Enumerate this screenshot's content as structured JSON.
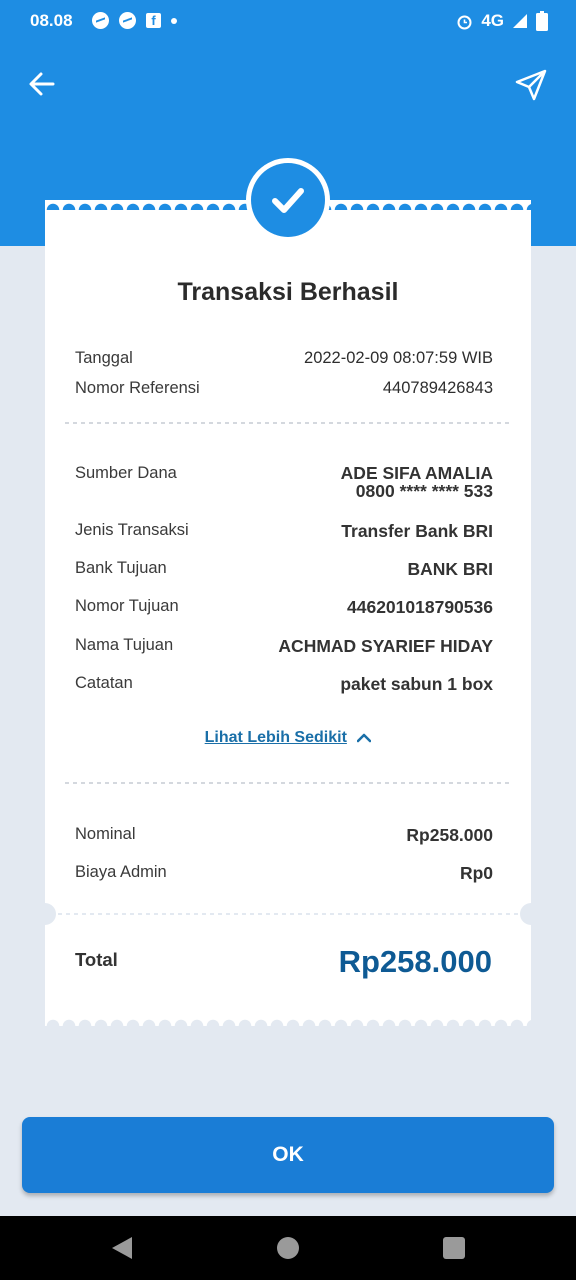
{
  "status_bar": {
    "time": "08.08",
    "network": "4G"
  },
  "title": "Transaksi Berhasil",
  "section1": [
    {
      "label": "Tanggal",
      "value": "2022-02-09 08:07:59 WIB"
    },
    {
      "label": "Nomor Referensi",
      "value": "440789426843"
    }
  ],
  "details": {
    "source": {
      "label": "Sumber Dana",
      "name": "ADE SIFA AMALIA",
      "account": "0800 **** **** 533"
    },
    "rows": [
      {
        "label": "Jenis Transaksi",
        "value": "Transfer Bank BRI"
      },
      {
        "label": "Bank Tujuan",
        "value": "BANK BRI"
      },
      {
        "label": "Nomor Tujuan",
        "value": "446201018790536"
      },
      {
        "label": "Nama Tujuan",
        "value": "ACHMAD SYARIEF HIDAY"
      },
      {
        "label": "Catatan",
        "value": "paket sabun 1 box"
      }
    ]
  },
  "see_less": "Lihat Lebih Sedikit",
  "amounts": [
    {
      "label": "Nominal",
      "value": "Rp258.000"
    },
    {
      "label": "Biaya Admin",
      "value": "Rp0"
    }
  ],
  "total": {
    "label": "Total",
    "value": "Rp258.000"
  },
  "ok_button": "OK",
  "icons": {
    "back": "arrow-left-icon",
    "share": "send-icon",
    "success": "check-icon"
  },
  "colors": {
    "primary": "#1e8de3",
    "total": "#0e5a94",
    "link": "#1a6fa8"
  }
}
